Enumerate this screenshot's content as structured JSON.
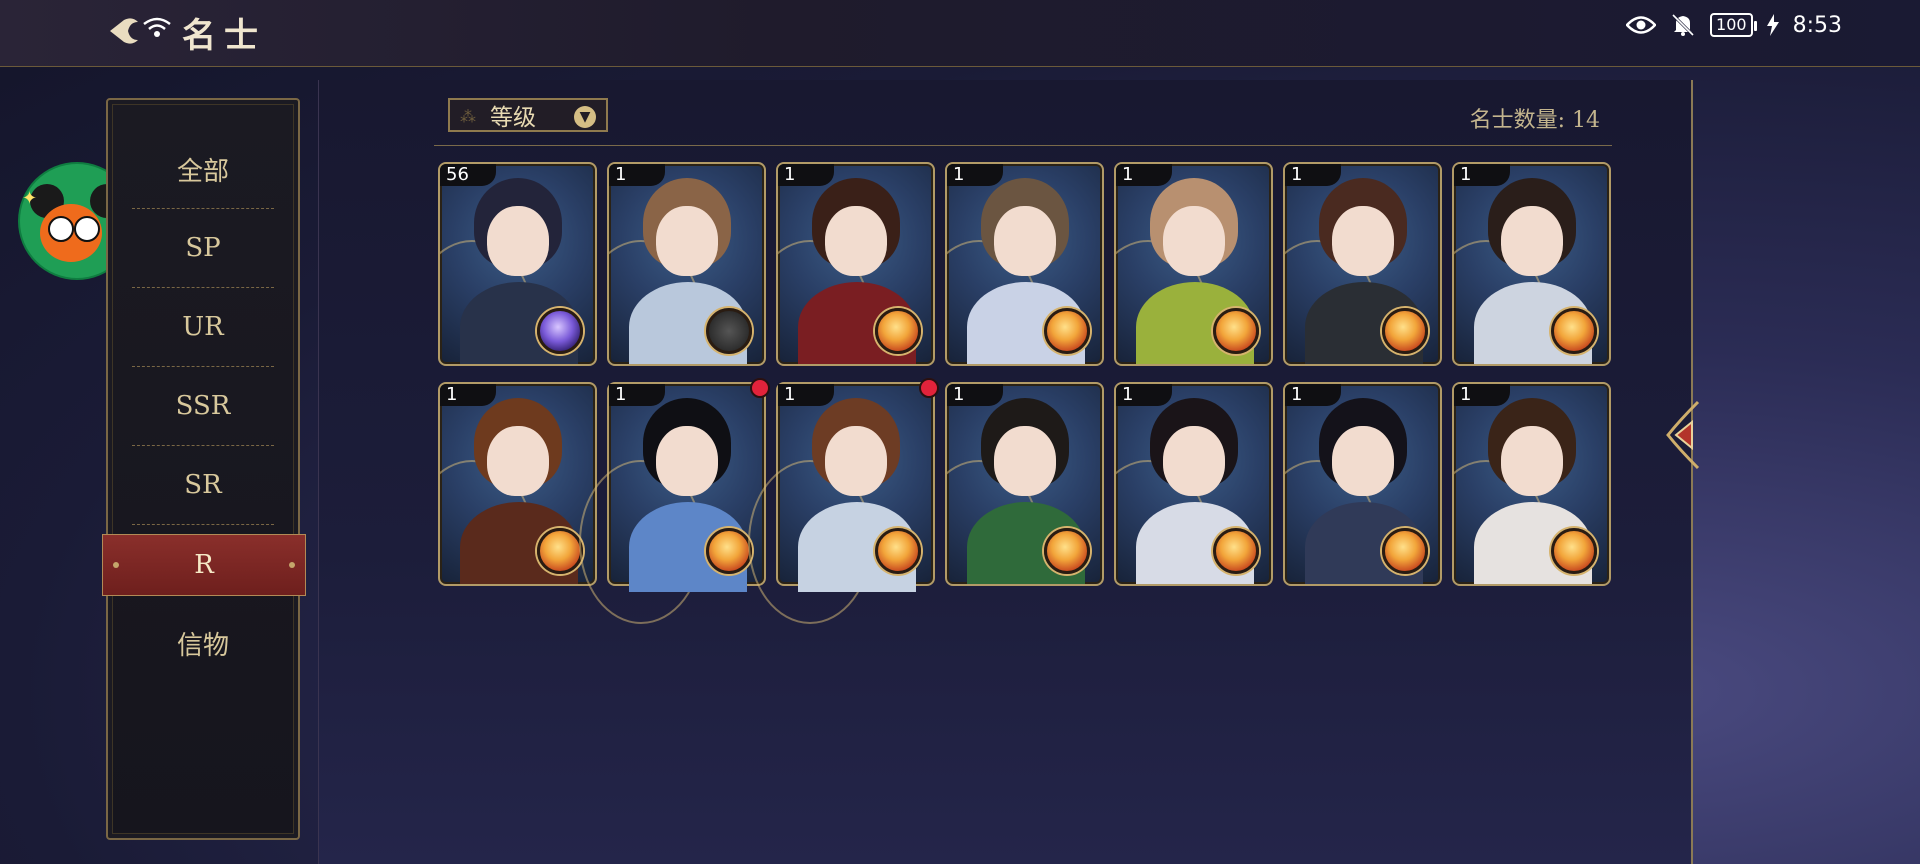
{
  "header": {
    "title": "名士",
    "status": {
      "battery": "100",
      "time": "8:53"
    }
  },
  "sidebar": {
    "items": [
      {
        "label": "全部"
      },
      {
        "label": "SP"
      },
      {
        "label": "UR"
      },
      {
        "label": "SSR"
      },
      {
        "label": "SR"
      },
      {
        "label": "R"
      },
      {
        "label": "信物"
      }
    ],
    "active_index": 5
  },
  "toolbar": {
    "sort_label": "等级",
    "count_text": "名士数量: 14"
  },
  "cards": [
    {
      "level": "56",
      "hair": "#23243a",
      "body": "#28324a",
      "badge": "purple"
    },
    {
      "level": "1",
      "hair": "#8a6447",
      "body": "#b9c8dc",
      "badge": "grey"
    },
    {
      "level": "1",
      "hair": "#3a2018",
      "body": "#7a1e22",
      "badge": "orange"
    },
    {
      "level": "1",
      "hair": "#6b5541",
      "body": "#c9d2e6",
      "badge": "orange"
    },
    {
      "level": "1",
      "hair": "#b89070",
      "body": "#9ab13c",
      "badge": "orange"
    },
    {
      "level": "1",
      "hair": "#4a2a20",
      "body": "#2a2e34",
      "badge": "orange"
    },
    {
      "level": "1",
      "hair": "#2a1e1a",
      "body": "#cdd4e0",
      "badge": "orange"
    },
    {
      "level": "1",
      "hair": "#6e3a1e",
      "body": "#5a2a1c",
      "badge": "orange",
      "alert": false
    },
    {
      "level": "1",
      "hair": "#0f0f14",
      "body": "#5d86c8",
      "badge": "orange",
      "alert": true
    },
    {
      "level": "1",
      "hair": "#6d3c24",
      "body": "#c6d2e2",
      "badge": "orange",
      "alert": true
    },
    {
      "level": "1",
      "hair": "#1e1a18",
      "body": "#2f6a3a",
      "badge": "orange"
    },
    {
      "level": "1",
      "hair": "#1a1418",
      "body": "#d7dbe6",
      "badge": "orange"
    },
    {
      "level": "1",
      "hair": "#14121a",
      "body": "#303a58",
      "badge": "orange"
    },
    {
      "level": "1",
      "hair": "#3a2418",
      "body": "#e6e2e0",
      "badge": "orange"
    }
  ],
  "colors": {
    "accent_gold": "#b29b67",
    "active_tab": "#8a2f2b",
    "alert_dot": "#e2233b"
  }
}
